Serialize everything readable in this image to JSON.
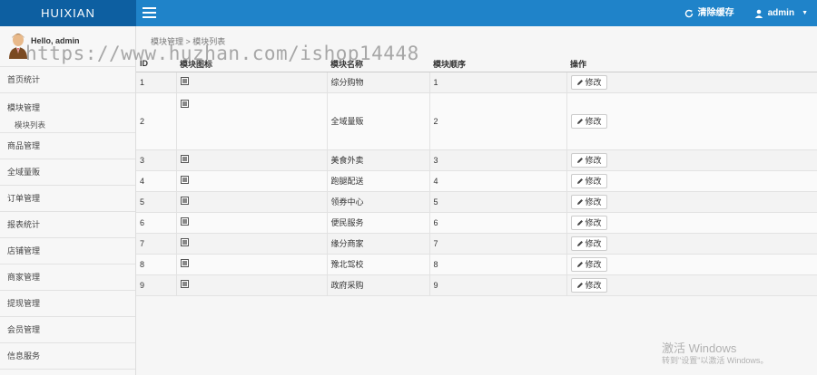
{
  "header": {
    "brand": "HUIXIAN",
    "clear_cache": "清除缓存",
    "user": "admin"
  },
  "sidebar": {
    "greeting": "Hello, admin",
    "items": [
      {
        "label": "首页统计"
      },
      {
        "label": "模块管理",
        "sub": "模块列表"
      },
      {
        "label": "商品管理"
      },
      {
        "label": "全域量贩"
      },
      {
        "label": "订单管理"
      },
      {
        "label": "报表统计"
      },
      {
        "label": "店铺管理"
      },
      {
        "label": "商家管理"
      },
      {
        "label": "提现管理"
      },
      {
        "label": "会员管理"
      },
      {
        "label": "信息服务"
      }
    ]
  },
  "breadcrumb": "模块管理 > 模块列表",
  "table": {
    "headers": [
      "ID",
      "模块图标",
      "模块名称",
      "模块顺序",
      "操作"
    ],
    "edit_label": "修改",
    "rows": [
      {
        "id": "1",
        "name": "综分购物",
        "order": "1"
      },
      {
        "id": "2",
        "name": "全域量贩",
        "order": "2"
      },
      {
        "id": "3",
        "name": "美食外卖",
        "order": "3"
      },
      {
        "id": "4",
        "name": "跑腿配送",
        "order": "4"
      },
      {
        "id": "5",
        "name": "领券中心",
        "order": "5"
      },
      {
        "id": "6",
        "name": "便民服务",
        "order": "6"
      },
      {
        "id": "7",
        "name": "缘分商家",
        "order": "7"
      },
      {
        "id": "8",
        "name": "豫北驾校",
        "order": "8"
      },
      {
        "id": "9",
        "name": "政府采购",
        "order": "9"
      }
    ]
  },
  "watermark": {
    "url": "https://www.huzhan.com/ishop14448",
    "win_title": "激活 Windows",
    "win_sub": "转到\"设置\"以激活 Windows。"
  },
  "colors": {
    "topbar": "#1f83c9",
    "brand_bg": "#0d5fa1"
  }
}
